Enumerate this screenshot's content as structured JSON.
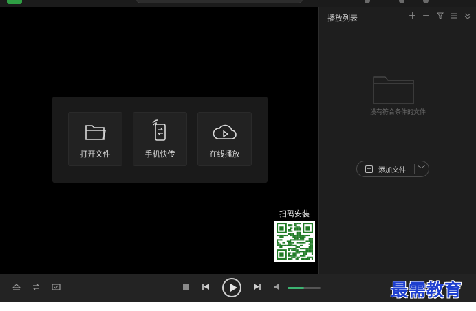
{
  "tiles": [
    {
      "label": "打开文件",
      "icon": "folder-icon"
    },
    {
      "label": "手机快传",
      "icon": "phone-transfer-icon"
    },
    {
      "label": "在线播放",
      "icon": "cloud-play-icon"
    }
  ],
  "qr": {
    "title": "扫码安装",
    "fg": "#1e7a24"
  },
  "playlist": {
    "title": "播放列表",
    "empty_text": "没有符合条件的文件",
    "add_label": "添加文件",
    "header_icons": [
      "add-icon",
      "remove-icon",
      "filter-icon",
      "list-icon",
      "collapse-icon"
    ]
  },
  "controls": {
    "volume_level": 0.5,
    "accent": "#3cb371"
  },
  "watermark": "最需教育"
}
